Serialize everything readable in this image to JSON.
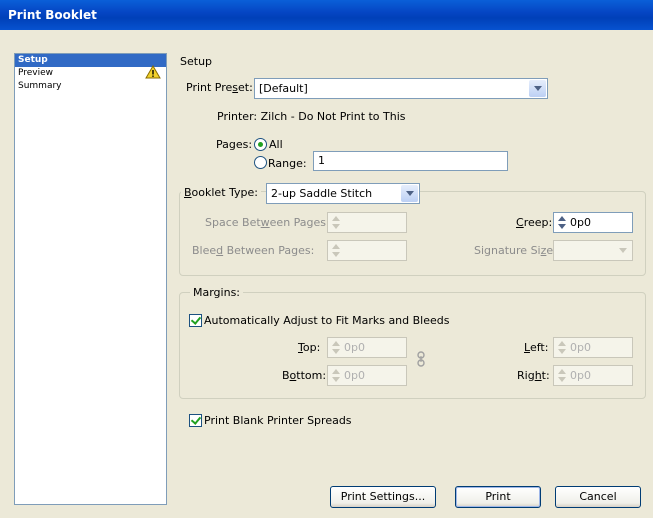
{
  "window": {
    "title": "Print Booklet"
  },
  "sidebar": {
    "items": [
      {
        "label": "Setup",
        "selected": true
      },
      {
        "label": "Preview",
        "warning": true
      },
      {
        "label": "Summary"
      }
    ]
  },
  "setup": {
    "heading": "Setup",
    "print_preset_label_pre": "Print Pre",
    "print_preset_label_u": "s",
    "print_preset_label_post": "et:",
    "print_preset_value": "[Default]",
    "printer_text": "Printer: Zilch - Do Not Print to This",
    "pages_label": "Pages:",
    "pages_all_label": "All",
    "pages_range_label": "Range:",
    "pages_range_value": "1"
  },
  "booklet": {
    "type_label_u": "B",
    "type_label_rest": "ooklet Type:",
    "type_value": "2-up Saddle Stitch",
    "space_label_pre": "Space Bet",
    "space_label_u": "w",
    "space_label_post": "een Pages:",
    "bleed_label_pre": "Blee",
    "bleed_label_u": "d",
    "bleed_label_post": " Between Pages:",
    "creep_label_u": "C",
    "creep_label_rest": "reep:",
    "creep_value": "0p0",
    "signature_label_pre": "Signature Si",
    "signature_label_u": "z",
    "signature_label_post": "e:"
  },
  "margins": {
    "legend": "Margins:",
    "auto_adjust_label": "Automatically Adjust to Fit Marks and Bleeds",
    "auto_adjust_checked": true,
    "top_label_u": "T",
    "top_label_rest": "op:",
    "top_value": "0p0",
    "bottom_label_pre": "B",
    "bottom_label_u": "o",
    "bottom_label_post": "ttom:",
    "bottom_value": "0p0",
    "left_label_u": "L",
    "left_label_rest": "eft:",
    "left_value": "0p0",
    "right_label_pre": "Rig",
    "right_label_u": "h",
    "right_label_post": "t:",
    "right_value": "0p0"
  },
  "print_blank": {
    "label": "Print Blank Printer Spreads",
    "checked": true
  },
  "buttons": {
    "print_settings": "Print Settings...",
    "print": "Print",
    "cancel": "Cancel"
  },
  "colors": {
    "title_bar": "#0A5FD8",
    "selection": "#316AC5",
    "dialog_bg": "#ECE9D8"
  }
}
